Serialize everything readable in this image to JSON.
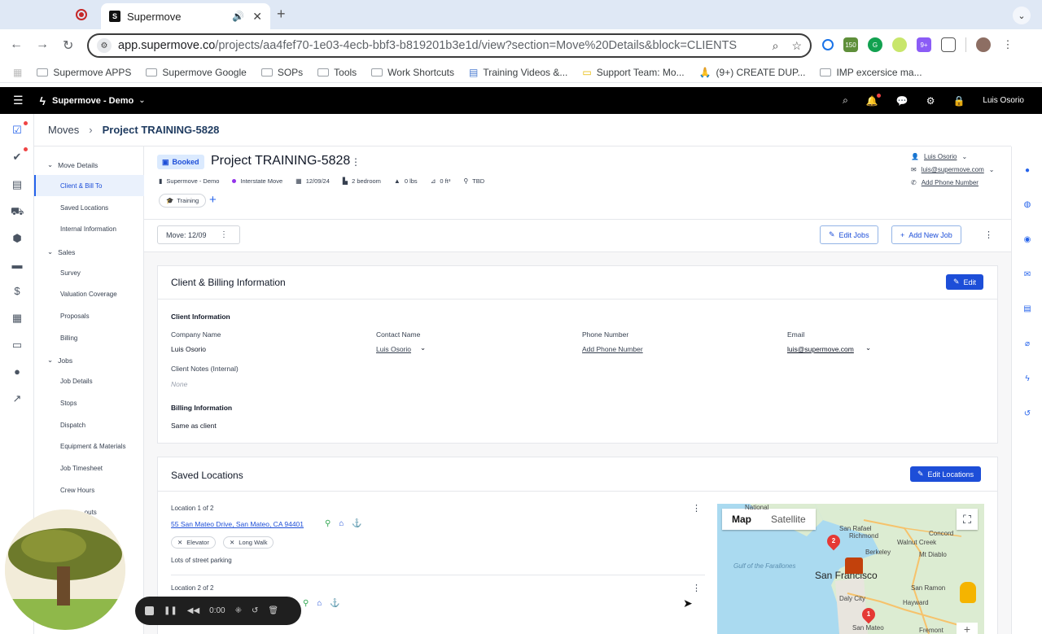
{
  "browser": {
    "tab_title": "Supermove",
    "url_main": "app.supermove.co",
    "url_rest": "/projects/aa4fef70-1e03-4ecb-bbf3-b819201b3e1d/view?section=Move%20Details&block=CLIENTS",
    "bookmarks": [
      "Supermove APPS",
      "Supermove Google",
      "SOPs",
      "Tools",
      "Work Shortcuts",
      "Training Videos &...",
      "Support Team: Mo...",
      "(9+) CREATE DUP...",
      "IMP excersice ma..."
    ],
    "ext_badges": [
      "150",
      "9+"
    ]
  },
  "appbar": {
    "org_name": "Supermove - Demo",
    "user_name": "Luis Osorio"
  },
  "breadcrumb": {
    "root": "Moves",
    "current": "Project TRAINING-5828"
  },
  "sidenav": {
    "sections": [
      {
        "label": "Move Details",
        "items": [
          "Client & Bill To",
          "Saved Locations",
          "Internal Information"
        ]
      },
      {
        "label": "Sales",
        "items": [
          "Survey",
          "Valuation Coverage",
          "Proposals",
          "Billing"
        ]
      },
      {
        "label": "Jobs",
        "items": [
          "Job Details",
          "Stops",
          "Dispatch",
          "Equipment & Materials",
          "Job Timesheet",
          "Crew Hours",
          "...outs"
        ]
      }
    ]
  },
  "project": {
    "status": "Booked",
    "title": "Project TRAINING-5828",
    "meta": [
      "Supermove - Demo",
      "Interstate Move",
      "12/09/24",
      "2 bedroom",
      "0 lbs",
      "0 ft³",
      "TBD"
    ],
    "tag": "Training",
    "contact_name": "Luis Osorio",
    "contact_email": "luis@supermove.com",
    "contact_phone_link": "Add Phone Number"
  },
  "move_bar": {
    "move_select": "Move: 12/09",
    "edit_jobs": "Edit Jobs",
    "add_new_job": "Add New Job"
  },
  "client_card": {
    "title": "Client & Billing Information",
    "edit": "Edit",
    "client_info_heading": "Client Information",
    "company_name_label": "Company Name",
    "company_name": "Luis Osorio",
    "contact_name_label": "Contact Name",
    "contact_name": "Luis Osorio",
    "phone_label": "Phone Number",
    "phone_value": "Add Phone Number",
    "email_label": "Email",
    "email_value": "luis@supermove.com",
    "notes_label": "Client Notes (Internal)",
    "notes_value": "None",
    "billing_heading": "Billing Information",
    "billing_value": "Same as client"
  },
  "locations_card": {
    "title": "Saved Locations",
    "edit": "Edit Locations",
    "loc1_label": "Location 1 of 2",
    "loc1_address": "55 San Mateo Drive, San Mateo, CA 94401",
    "loc1_chips": [
      "Elevator",
      "Long Walk"
    ],
    "loc1_note": "Lots of street parking",
    "loc2_label": "Location 2 of 2"
  },
  "map": {
    "tab_map": "Map",
    "tab_satellite": "Satellite",
    "places": [
      "National",
      "San Rafael",
      "Richmond",
      "Walnut Creek",
      "Concord",
      "Berkeley",
      "Mt Diablo",
      "San Francisco",
      "San Ramon",
      "Gulf of the Farallones",
      "Daly City",
      "Hayward",
      "San Mateo",
      "Fremont"
    ],
    "pins": [
      "2",
      "1"
    ]
  },
  "recorder": {
    "time": "0:00"
  }
}
